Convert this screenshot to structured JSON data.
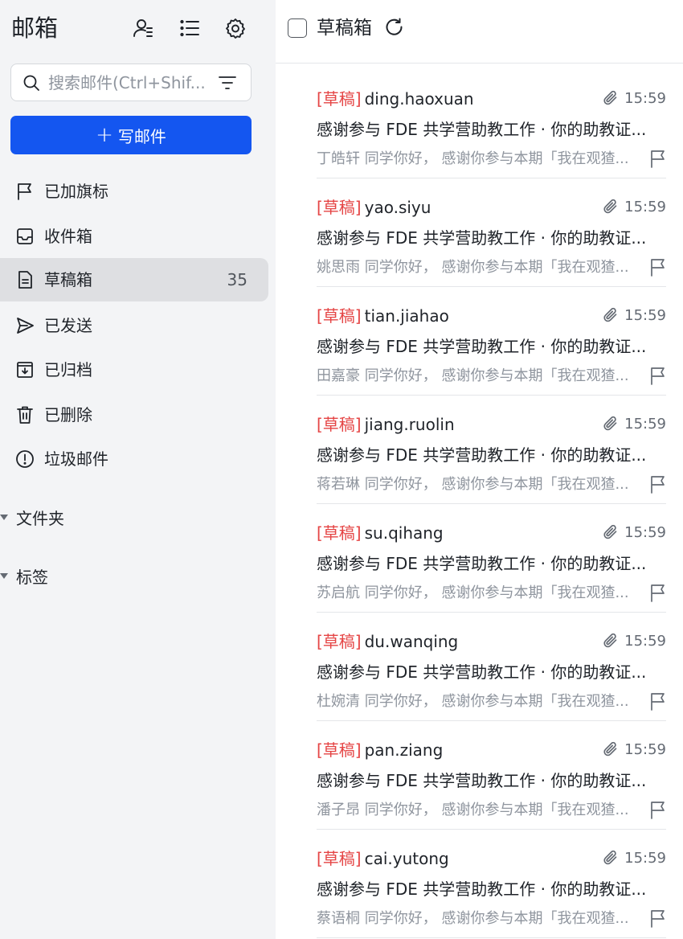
{
  "sidebar": {
    "title": "邮箱",
    "search_placeholder": "搜索邮件(Ctrl+Shif...",
    "compose_label": "写邮件",
    "items": [
      {
        "label": "已加旗标",
        "icon": "flag-icon",
        "count": ""
      },
      {
        "label": "收件箱",
        "icon": "inbox-icon",
        "count": ""
      },
      {
        "label": "草稿箱",
        "icon": "draft-icon",
        "count": "35"
      },
      {
        "label": "已发送",
        "icon": "send-icon",
        "count": ""
      },
      {
        "label": "已归档",
        "icon": "archive-icon",
        "count": ""
      },
      {
        "label": "已删除",
        "icon": "trash-icon",
        "count": ""
      },
      {
        "label": "垃圾邮件",
        "icon": "spam-icon",
        "count": ""
      }
    ],
    "groups": [
      {
        "label": "文件夹"
      },
      {
        "label": "标签"
      }
    ]
  },
  "main": {
    "title": "草稿箱",
    "mails": [
      {
        "tag": "[草稿]",
        "sender": "ding.haoxuan",
        "time": "15:59",
        "subject": "感谢参与 FDE 共学营助教工作 · 你的助教证...",
        "preview": "丁皓轩 同学你好， 感谢你参与本期「我在观猹..."
      },
      {
        "tag": "[草稿]",
        "sender": "yao.siyu",
        "time": "15:59",
        "subject": "感谢参与 FDE 共学营助教工作 · 你的助教证...",
        "preview": "姚思雨 同学你好， 感谢你参与本期「我在观猹..."
      },
      {
        "tag": "[草稿]",
        "sender": "tian.jiahao",
        "time": "15:59",
        "subject": "感谢参与 FDE 共学营助教工作 · 你的助教证...",
        "preview": "田嘉豪 同学你好， 感谢你参与本期「我在观猹..."
      },
      {
        "tag": "[草稿]",
        "sender": "jiang.ruolin",
        "time": "15:59",
        "subject": "感谢参与 FDE 共学营助教工作 · 你的助教证...",
        "preview": "蒋若琳 同学你好， 感谢你参与本期「我在观猹..."
      },
      {
        "tag": "[草稿]",
        "sender": "su.qihang",
        "time": "15:59",
        "subject": "感谢参与 FDE 共学营助教工作 · 你的助教证...",
        "preview": "苏启航 同学你好， 感谢你参与本期「我在观猹..."
      },
      {
        "tag": "[草稿]",
        "sender": "du.wanqing",
        "time": "15:59",
        "subject": "感谢参与 FDE 共学营助教工作 · 你的助教证...",
        "preview": "杜婉清 同学你好， 感谢你参与本期「我在观猹..."
      },
      {
        "tag": "[草稿]",
        "sender": "pan.ziang",
        "time": "15:59",
        "subject": "感谢参与 FDE 共学营助教工作 · 你的助教证...",
        "preview": "潘子昂 同学你好， 感谢你参与本期「我在观猹..."
      },
      {
        "tag": "[草稿]",
        "sender": "cai.yutong",
        "time": "15:59",
        "subject": "感谢参与 FDE 共学营助教工作 · 你的助教证...",
        "preview": "蔡语桐 同学你好， 感谢你参与本期「我在观猹..."
      }
    ]
  },
  "colors": {
    "accent": "#1456f0",
    "draft_tag": "#e54545",
    "sidebar_bg": "#f3f4f6",
    "active_bg": "#dedfe2"
  }
}
